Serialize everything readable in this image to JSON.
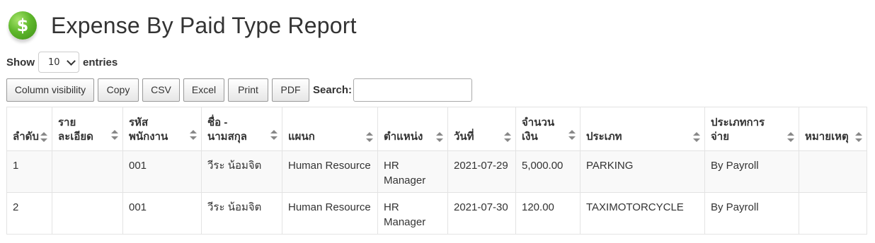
{
  "header": {
    "logo_icon": "dollar-coin-icon",
    "logo_symbol": "$",
    "title": "Expense By Paid Type Report"
  },
  "length_control": {
    "show_label": "Show",
    "selected": "10",
    "entries_label": "entries"
  },
  "toolbar": {
    "buttons": [
      "Column visibility",
      "Copy",
      "CSV",
      "Excel",
      "Print",
      "PDF"
    ],
    "search_label": "Search:",
    "search_value": ""
  },
  "table": {
    "columns": [
      "ลำดับ",
      "รายละเอียด",
      "รหัสพนักงาน",
      "ชื่อ - นามสกุล",
      "แผนก",
      "ตำแหน่ง",
      "วันที่",
      "จำนวนเงิน",
      "ประเภท",
      "ประเภทการจ่าย",
      "หมายเหตุ"
    ],
    "rows": [
      [
        "1",
        "",
        "001",
        "วีระ น้อมจิต",
        "Human Resource",
        "HR Manager",
        "2021-07-29",
        "5,000.00",
        "PARKING",
        "By Payroll",
        ""
      ],
      [
        "2",
        "",
        "001",
        "วีระ น้อมจิต",
        "Human Resource",
        "HR Manager",
        "2021-07-30",
        "120.00",
        "TAXIMOTORCYCLE",
        "By Payroll",
        ""
      ]
    ]
  }
}
